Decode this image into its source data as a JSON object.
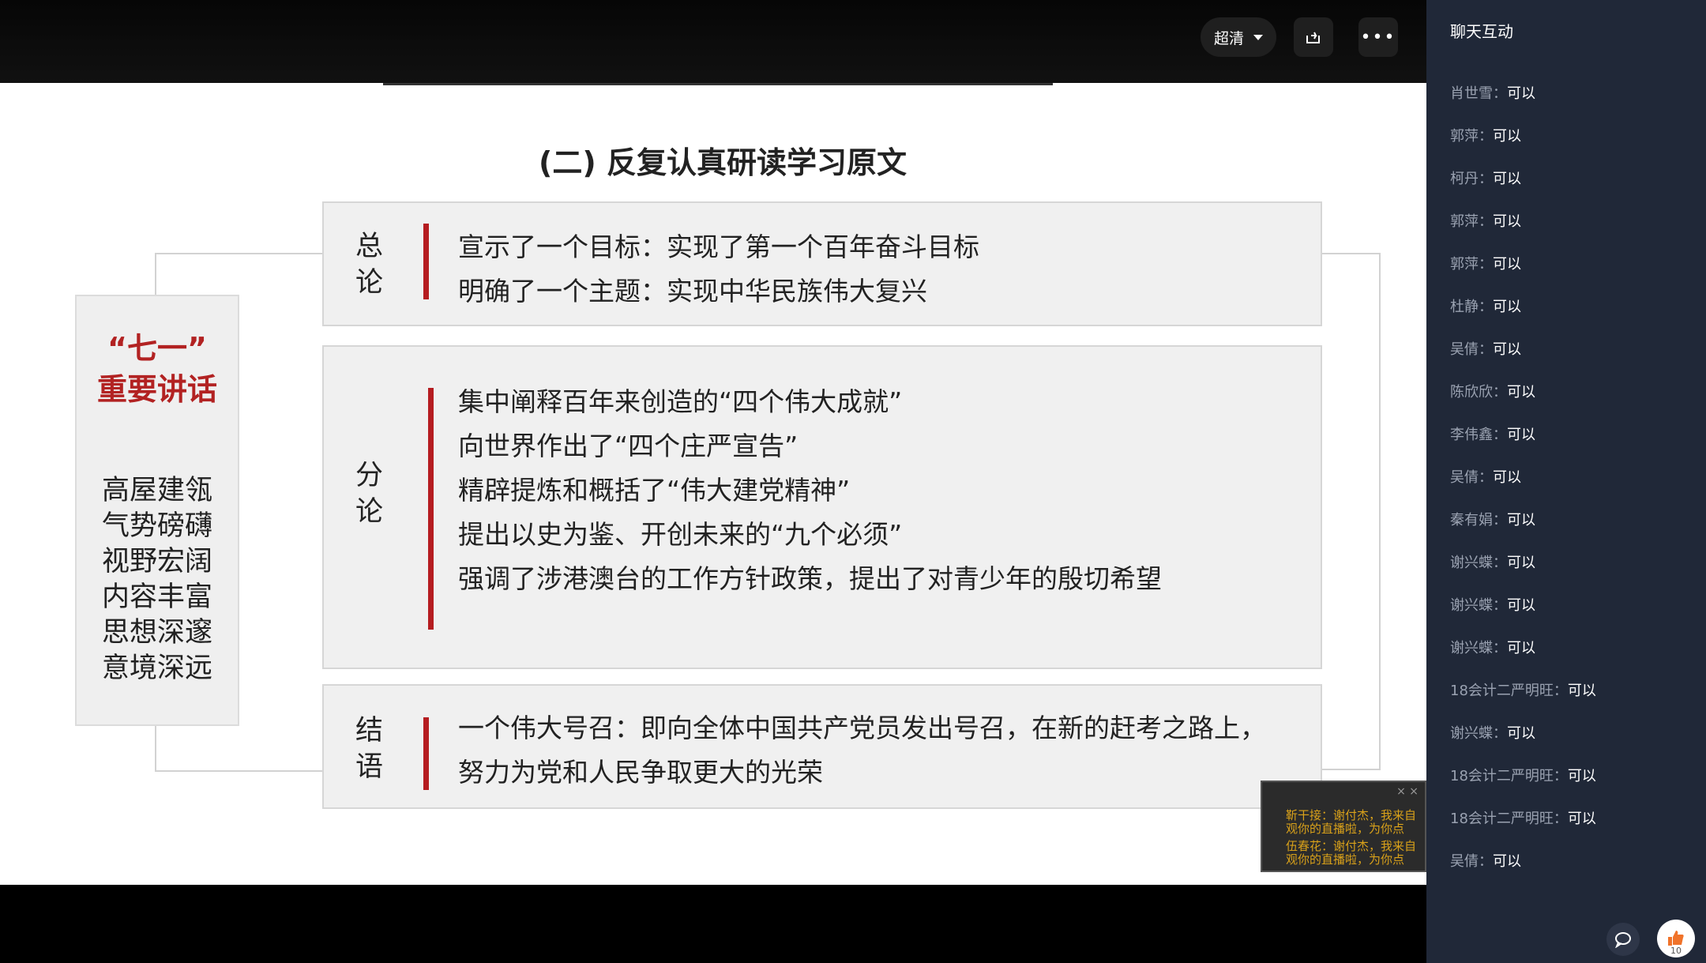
{
  "player": {
    "quality_label": "超清",
    "share_icon": "share-icon",
    "more_label": "•••"
  },
  "slide": {
    "title": "(二) 反复认真研读学习原文",
    "left_panel": {
      "title_line1": "“七一”",
      "title_line2": "重要讲话",
      "phrases": [
        "高屋建瓴",
        "气势磅礴",
        "视野宏阔",
        "内容丰富",
        "思想深邃",
        "意境深远"
      ]
    },
    "sections": [
      {
        "label_line1": "总",
        "label_line2": "论",
        "lines": [
          "宣示了一个目标：实现了第一个百年奋斗目标",
          "明确了一个主题：实现中华民族伟大复兴"
        ]
      },
      {
        "label_line1": "分",
        "label_line2": "论",
        "lines": [
          "集中阐释百年来创造的“四个伟大成就”",
          "向世界作出了“四个庄严宣告”",
          "精辟提炼和概括了“伟大建党精神”",
          "提出以史为鉴、开创未来的“九个必须”",
          "强调了涉港澳台的工作方针政策，提出了对青少年的殷切希望"
        ]
      },
      {
        "label_line1": "结",
        "label_line2": "语",
        "lines": [
          "一个伟大号召：即向全体中国共产党员发出号召，在新的赶考之路上，",
          "努力为党和人民争取更大的光荣"
        ]
      }
    ]
  },
  "danmaku": {
    "messages": [
      "靳干接：谢付杰，我来自",
      "观你的直播啦，为你点",
      "伍春花：谢付杰，我来自",
      "观你的直播啦，为你点"
    ],
    "close_label": "× ×"
  },
  "chat": {
    "title": "聊天互动",
    "messages": [
      {
        "nick": "肖世雪：",
        "text": "可以"
      },
      {
        "nick": "郭萍：",
        "text": "可以"
      },
      {
        "nick": "柯丹：",
        "text": "可以"
      },
      {
        "nick": "郭萍：",
        "text": "可以"
      },
      {
        "nick": "郭萍：",
        "text": "可以"
      },
      {
        "nick": "杜静：",
        "text": "可以"
      },
      {
        "nick": "吴倩：",
        "text": "可以"
      },
      {
        "nick": "陈欣欣：",
        "text": "可以"
      },
      {
        "nick": "李伟鑫：",
        "text": "可以"
      },
      {
        "nick": "吴倩：",
        "text": "可以"
      },
      {
        "nick": "秦有娟：",
        "text": "可以"
      },
      {
        "nick": "谢兴蝶：",
        "text": "可以"
      },
      {
        "nick": "谢兴蝶：",
        "text": "可以"
      },
      {
        "nick": "谢兴蝶：",
        "text": "可以"
      },
      {
        "nick": "18会计二严明旺：",
        "text": "可以"
      },
      {
        "nick": "谢兴蝶：",
        "text": "可以"
      },
      {
        "nick": "18会计二严明旺：",
        "text": "可以"
      },
      {
        "nick": "18会计二严明旺：",
        "text": "可以"
      },
      {
        "nick": "吴倩：",
        "text": "可以"
      }
    ],
    "like_count": "10"
  }
}
